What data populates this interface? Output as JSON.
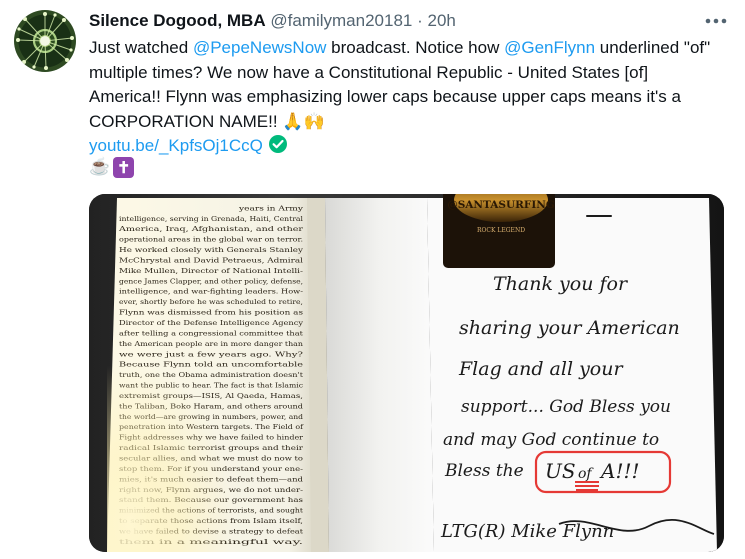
{
  "author": {
    "name": "Silence Dogood, MBA",
    "handle": "@familyman20181",
    "separator": "·",
    "time": "20h"
  },
  "tweet": {
    "part1": "Just watched ",
    "mention1": "@PepeNewsNow",
    "part2": " broadcast. Notice how ",
    "mention2": "@GenFlynn",
    "part3": " underlined \"of\" multiple times? We now have a Constitutional Republic - United States [of] America!! Flynn was emphasizing lower caps because upper caps means it's a CORPORATION NAME!! ",
    "emoji1": "🙏",
    "emoji2": "🙌",
    "link": "youtu.be/_KpfsOj1CcQ",
    "emoji3": "☕",
    "emoji4": "✝"
  },
  "icons": {
    "more": "more-horizontal-icon",
    "verified": "verified-check-icon"
  },
  "colors": {
    "link": "#1d9bf0",
    "secondary": "#536471",
    "verified": "#00ba7c",
    "cross_box": "#8e44ad",
    "marker": "#e53935"
  },
  "photo": {
    "book_lines": [
      "years in Army",
      "intelligence, serving in Grenada, Haiti, Central",
      "America, Iraq, Afghanistan, and other",
      "operational areas in the global war on terror.",
      "He worked closely with Generals Stanley",
      "McChrystal and David Petraeus, Admiral",
      "Mike Mullen, Director of National Intelli-",
      "gence James Clapper, and other policy, defense,",
      "intelligence, and war-fighting leaders. How-",
      "ever, shortly before he was scheduled to retire,",
      "Flynn was dismissed from his position as",
      "Director of the Defense Intelligence Agency",
      "after telling a congressional committee that",
      "the American people are in more danger than",
      "we were just a few years ago. Why?",
      "Because Flynn told an uncomfortable",
      "truth, one the Obama administration doesn't",
      "want the public to hear. The fact is that Islamic",
      "extremist groups—ISIS, Al Qaeda, Hamas,",
      "the Taliban, Boko Haram, and others around",
      "the world—are growing in numbers, power, and",
      "penetration into Western targets. The Field of",
      "Fight addresses why we have failed to hinder",
      "radical Islamic terrorist groups and their",
      "secular allies, and what we must do now to",
      "stop them. For if you understand your ene-",
      "mies, it's much easier to defeat them—and",
      "right now, Flynn argues, we do not under-",
      "stand them. Because our government has",
      "minimized the actions of terrorists, and sought",
      "to separate those actions from Islam itself,",
      "we have failed to devise a strategy to defeat",
      "them in a meaningful way."
    ],
    "sticker_text": "@SANTASURFING",
    "sticker_sub": "ROCK LEGEND",
    "note_lines": [
      "Thank you for",
      "sharing your American",
      "Flag and all your",
      "support... God Bless you",
      "and may God continue to",
      "Bless the"
    ],
    "note_us": "US",
    "note_of": "of",
    "note_a": "A!!!",
    "signature": "LTG(R) Mike Flynn"
  }
}
